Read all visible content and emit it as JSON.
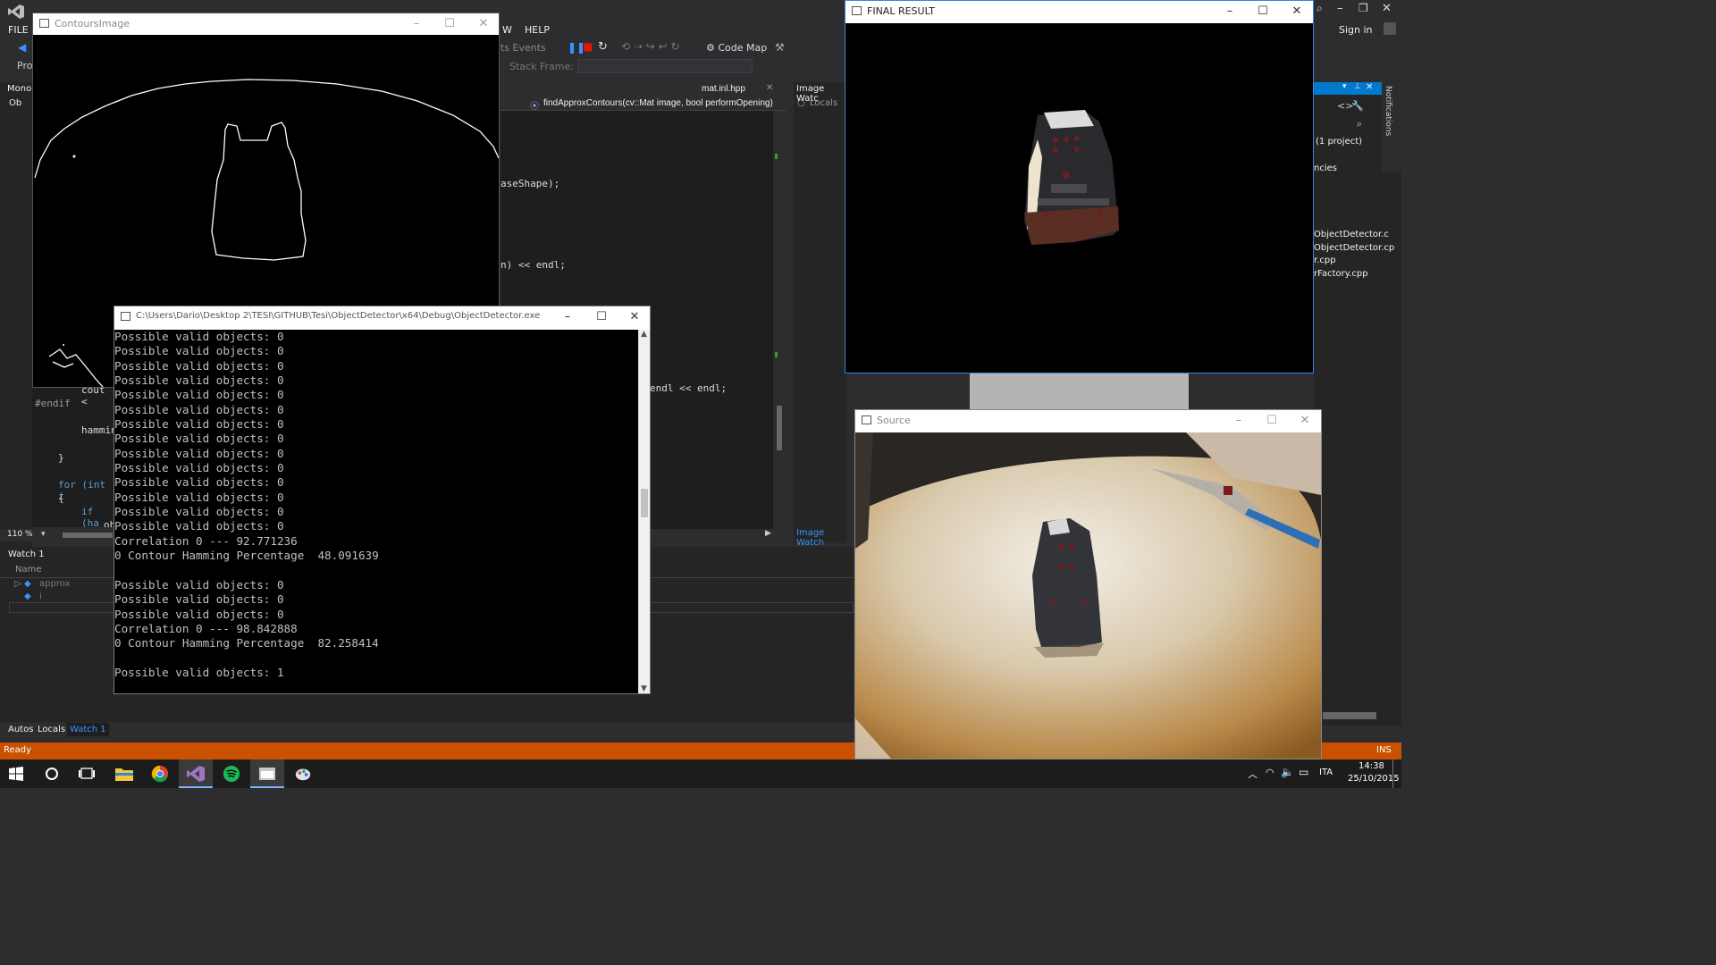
{
  "vs": {
    "menu": [
      "FILE",
      "HELP",
      "W"
    ],
    "sign_in": "Sign in",
    "toolbar": {
      "code_map": "Code Map",
      "events": "ts Events",
      "stack_frame": "Stack Frame:",
      "proc": "Proc"
    },
    "file_tab": "mat.inl.hpp",
    "func_dropdown": "findApproxContours(cv::Mat image, bool performOpening)",
    "code_lines": [
      "aseShape);",
      "n) << endl;",
      "endl << endl;"
    ],
    "left_code": [
      "cout <",
      "#endif",
      "hammin",
      "}",
      "for (int i",
      "{",
      "if (ha",
      "ob"
    ],
    "zoom": "110 %",
    "mono_label": "Mono",
    "ob_label": "Ob",
    "image_watch": {
      "title": "Image Watc",
      "locals": "Locals",
      "link": "Image Watch"
    },
    "watch": {
      "title": "Watch 1",
      "col_name": "Name",
      "rows": [
        "approx",
        "i"
      ]
    },
    "bottom_tabs": [
      "Autos",
      "Locals",
      "Watch 1"
    ],
    "status": {
      "left": "Ready",
      "right": "INS"
    },
    "solution": {
      "project": "(1 project)",
      "ncies": "ncies",
      "files": [
        "ObjectDetector.c",
        "ObjectDetector.cp",
        "r.cpp",
        "rFactory.cpp"
      ],
      "r": "r"
    },
    "notifications": "Notifications"
  },
  "windows": {
    "contours": {
      "title": "ContoursImage"
    },
    "final": {
      "title": "FINAL RESULT"
    },
    "source": {
      "title": "Source"
    },
    "console": {
      "title": "C:\\Users\\Dario\\Desktop 2\\TESI\\GITHUB\\Tesi\\ObjectDetector\\x64\\Debug\\ObjectDetector.exe",
      "lines": [
        "Possible valid objects: 0",
        "Possible valid objects: 0",
        "Possible valid objects: 0",
        "Possible valid objects: 0",
        "Possible valid objects: 0",
        "Possible valid objects: 0",
        "Possible valid objects: 0",
        "Possible valid objects: 0",
        "Possible valid objects: 0",
        "Possible valid objects: 0",
        "Possible valid objects: 0",
        "Possible valid objects: 0",
        "Possible valid objects: 0",
        "Possible valid objects: 0",
        "Correlation 0 --- 92.771236",
        "0 Contour Hamming Percentage  48.091639",
        "",
        "Possible valid objects: 0",
        "Possible valid objects: 0",
        "Possible valid objects: 0",
        "Correlation 0 --- 98.842888",
        "0 Contour Hamming Percentage  82.258414",
        "",
        "Possible valid objects: 1"
      ]
    }
  },
  "taskbar": {
    "time": "14:38",
    "date": "25/10/2015",
    "lang": "ITA",
    "apps": [
      "start-icon",
      "cortana-icon",
      "task-view-icon",
      "file-explorer-icon",
      "chrome-icon",
      "visual-studio-icon",
      "spotify-icon",
      "console-app-icon",
      "paint-app-icon"
    ]
  },
  "colors": {
    "accent": "#ca5100",
    "vs_bg": "#2d2d30",
    "editor_bg": "#1e1e1e",
    "link": "#3794ff"
  }
}
